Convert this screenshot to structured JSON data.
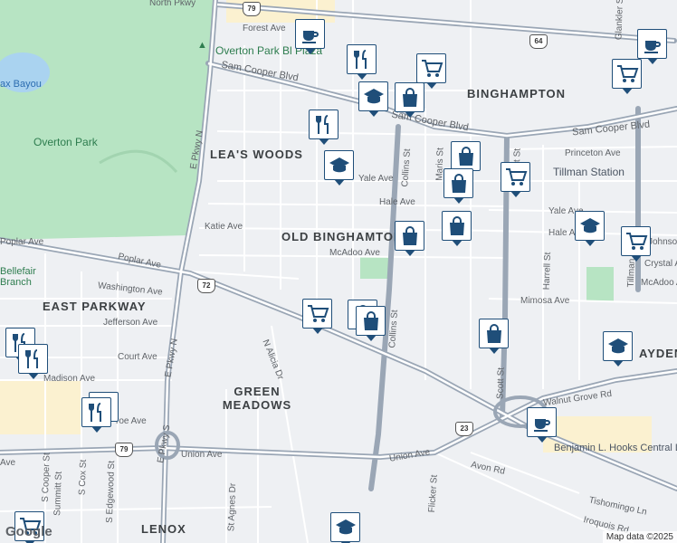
{
  "labels": {
    "neighborhoods": [
      "BINGHAMPTON",
      "LEA'S WOODS",
      "OLD BINGHAMTON",
      "EAST PARKWAY",
      "GREEN MEADOWS",
      "LENOX",
      "AYDEN"
    ],
    "places": [
      "Overton Park",
      "Overton Park Bl Plaza",
      "Tillman Station",
      "Bellefair Branch",
      "ax Bayou",
      "Benjamin L. Hooks Central Library"
    ],
    "streets": [
      "North Pkwy",
      "Forest Ave",
      "Sam Cooper Blvd",
      "Sam Cooper Blvd",
      "E Pkwy N",
      "E Pkwy N",
      "E Pkwy S",
      "Poplar Ave",
      "Poplar Ave",
      "Washington Ave",
      "Jefferson Ave",
      "Court Ave",
      "Madison Ave",
      "Union Ave",
      "Union Ave",
      "Katie Ave",
      "McAdoo Ave",
      "Hale Ave",
      "Hale Ave",
      "Yale Ave",
      "Yale Ave",
      "Princeton Ave",
      "Mimosa Ave",
      "Collins St",
      "Collins St",
      "Maris St",
      "Scott St",
      "Scott St",
      "Harrell St",
      "Tillman St",
      "N Alicia Dr",
      "Walnut Grove Rd",
      "Flicker St",
      "Tishomingo Ln",
      "Iroquois Rd",
      "Crystal Ave",
      "Johnson Ave",
      "McAdoo Ave",
      "S Cooper St",
      "S Cox St",
      "Summitt St",
      "S Edgewood St",
      "St Agnes Dr",
      "roe Ave",
      "Avon Rd",
      "Glankler St",
      "Ave"
    ],
    "shields": [
      "79",
      "64",
      "72",
      "79",
      "23"
    ]
  },
  "pois": [
    {
      "type": "cafe-icon"
    },
    {
      "type": "restaurant-icon"
    },
    {
      "type": "grocery-icon"
    },
    {
      "type": "grocery-icon"
    },
    {
      "type": "cafe-icon"
    },
    {
      "type": "school-icon"
    },
    {
      "type": "shopping-bag-icon"
    },
    {
      "type": "restaurant-icon"
    },
    {
      "type": "school-icon"
    },
    {
      "type": "shopping-bag-icon"
    },
    {
      "type": "grocery-icon"
    },
    {
      "type": "shopping-bag-icon"
    },
    {
      "type": "shopping-bag-icon"
    },
    {
      "type": "shopping-bag-icon"
    },
    {
      "type": "school-icon"
    },
    {
      "type": "grocery-icon"
    },
    {
      "type": "restaurant-icon"
    },
    {
      "type": "shopping-bag-icon"
    },
    {
      "type": "grocery-icon"
    },
    {
      "type": "shopping-bag-icon"
    },
    {
      "type": "shopping-bag-icon"
    },
    {
      "type": "school-icon"
    },
    {
      "type": "restaurant-icon"
    },
    {
      "type": "restaurant-icon"
    },
    {
      "type": "restaurant-icon"
    },
    {
      "type": "cafe-icon"
    },
    {
      "type": "grocery-icon"
    },
    {
      "type": "school-icon"
    }
  ],
  "footer": {
    "logo": "Google",
    "attribution": "Map data ©2025"
  }
}
